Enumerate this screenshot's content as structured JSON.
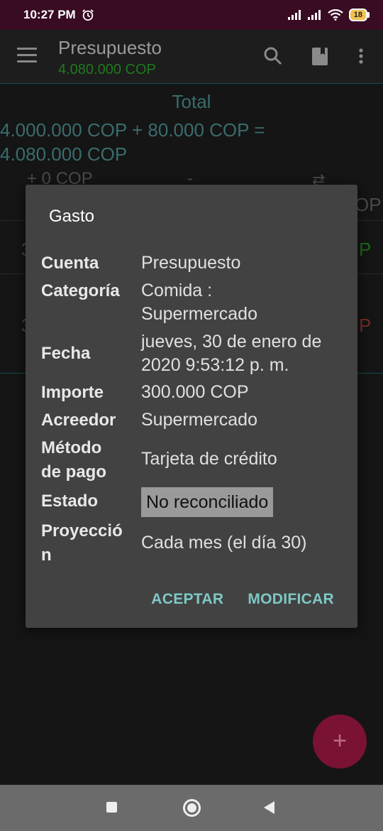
{
  "status_bar": {
    "time": "10:27 PM",
    "battery": "18"
  },
  "app_bar": {
    "title": "Presupuesto",
    "subtitle": "4.080.000 COP"
  },
  "background": {
    "total_label": "Total",
    "total_formula": "4.000.000 COP + 80.000 COP = 4.080.000 COP",
    "row_left": "+ 0 COP",
    "row_mid": "-",
    "row_arrow": "⇄",
    "edge_op": "OP",
    "edge_p1": "P",
    "edge_p2": "P",
    "edge_3a": "3",
    "edge_3b": "3"
  },
  "dialog": {
    "title": "Gasto",
    "fields": [
      {
        "label": "Cuenta",
        "value": "Presupuesto"
      },
      {
        "label": "Categoría",
        "value": "Comida : Supermercado"
      },
      {
        "label": "Fecha",
        "value": "jueves, 30 de enero de 2020 9:53:12 p. m."
      },
      {
        "label": "Importe",
        "value": "300.000 COP"
      },
      {
        "label": "Acreedor",
        "value": "Supermercado"
      },
      {
        "label": "Método de pago",
        "value": "Tarjeta de crédito"
      },
      {
        "label": "Estado",
        "value": "No reconciliado"
      },
      {
        "label": "Proyección",
        "value": "Cada mes (el día 30)"
      }
    ],
    "accept_label": "ACEPTAR",
    "modify_label": "MODIFICAR"
  },
  "fab": {
    "label": "+"
  },
  "colors": {
    "accent": "#7ec9c5",
    "status_bar": "#3a0c24",
    "fab": "#7a1233"
  },
  "icons": [
    "menu-icon",
    "search-icon",
    "book-icon",
    "more-vert-icon",
    "alarm-icon",
    "signal-icon",
    "wifi-icon",
    "battery-icon"
  ]
}
